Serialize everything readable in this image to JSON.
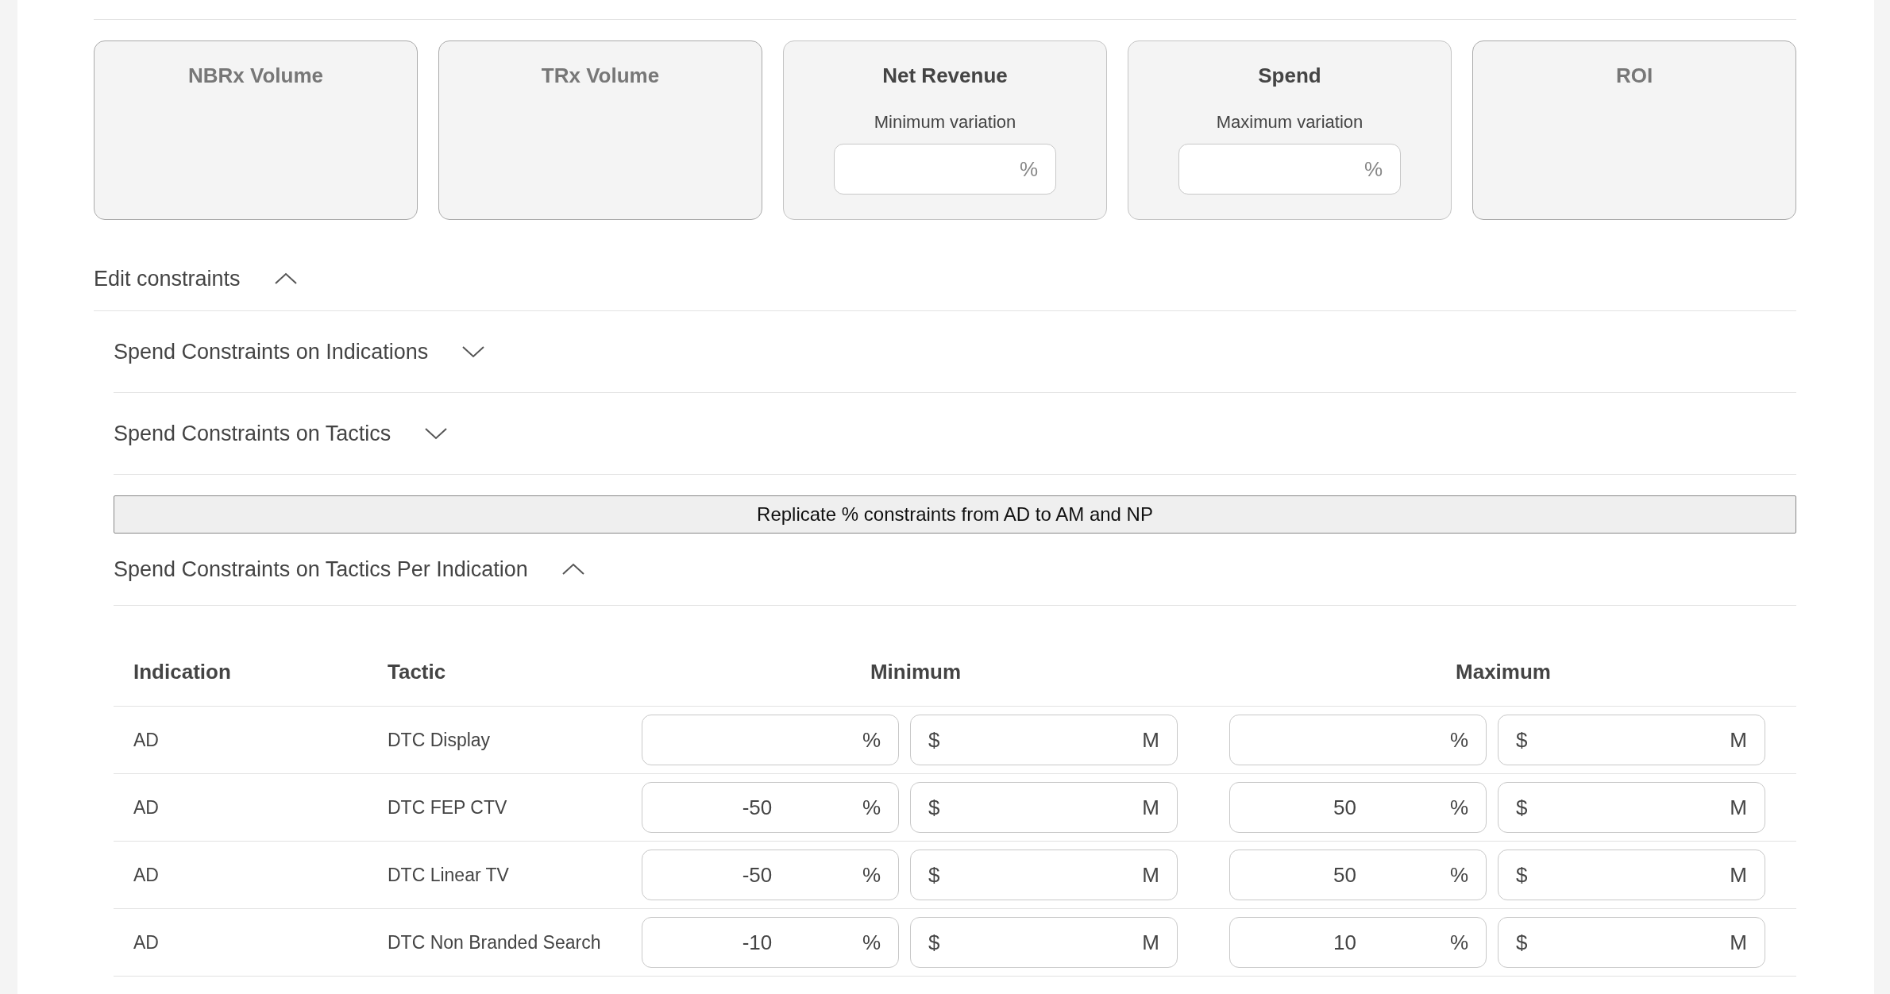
{
  "metric_cards": [
    {
      "title": "NBRx Volume",
      "disabled": true
    },
    {
      "title": "TRx Volume",
      "disabled": true
    },
    {
      "title": "Net Revenue",
      "disabled": false,
      "variation_label": "Minimum variation",
      "unit": "%"
    },
    {
      "title": "Spend",
      "disabled": false,
      "variation_label": "Maximum variation",
      "unit": "%"
    },
    {
      "title": "ROI",
      "disabled": true
    }
  ],
  "edit_constraints": {
    "label": "Edit constraints",
    "expanded": true,
    "items": [
      {
        "kind": "section",
        "label": "Spend Constraints on Indications",
        "expanded": false
      },
      {
        "kind": "section",
        "label": "Spend Constraints on Tactics",
        "expanded": false
      },
      {
        "kind": "button",
        "label": "Replicate % constraints from AD to AM and NP"
      },
      {
        "kind": "section",
        "label": "Spend Constraints on Tactics Per Indication",
        "expanded": true,
        "table": {
          "columns": [
            "Indication",
            "Tactic",
            "Minimum",
            "Maximum"
          ],
          "rows": [
            {
              "indication": "AD",
              "tactic": "DTC Display",
              "minimum": {
                "percent": {
                  "suffix": "%"
                },
                "amount": {
                  "prefix": "$",
                  "suffix": "M"
                }
              },
              "maximum": {
                "percent": {
                  "suffix": "%"
                },
                "amount": {
                  "prefix": "$",
                  "suffix": "M"
                }
              }
            },
            {
              "indication": "AD",
              "tactic": "DTC FEP CTV",
              "minimum": {
                "percent": {
                  "value": "-50",
                  "suffix": "%"
                },
                "amount": {
                  "prefix": "$",
                  "suffix": "M"
                }
              },
              "maximum": {
                "percent": {
                  "value": "50",
                  "suffix": "%"
                },
                "amount": {
                  "prefix": "$",
                  "suffix": "M"
                }
              }
            },
            {
              "indication": "AD",
              "tactic": "DTC Linear TV",
              "minimum": {
                "percent": {
                  "value": "-50",
                  "suffix": "%"
                },
                "amount": {
                  "prefix": "$",
                  "suffix": "M"
                }
              },
              "maximum": {
                "percent": {
                  "value": "50",
                  "suffix": "%"
                },
                "amount": {
                  "prefix": "$",
                  "suffix": "M"
                }
              }
            },
            {
              "indication": "AD",
              "tactic": "DTC Non Branded Search",
              "minimum": {
                "percent": {
                  "value": "-10",
                  "suffix": "%"
                },
                "amount": {
                  "prefix": "$",
                  "suffix": "M"
                }
              },
              "maximum": {
                "percent": {
                  "value": "10",
                  "suffix": "%"
                },
                "amount": {
                  "prefix": "$",
                  "suffix": "M"
                }
              }
            }
          ]
        }
      }
    ]
  }
}
